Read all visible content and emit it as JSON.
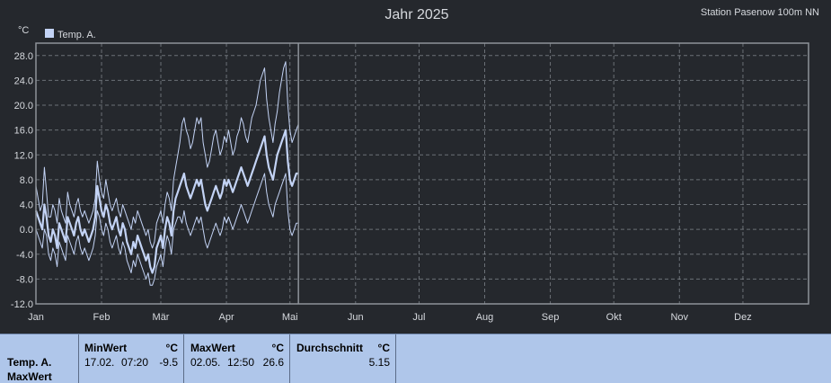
{
  "title": "Jahr 2025",
  "station": "Station Pasenow 100m NN",
  "unit": "°C",
  "colors": {
    "background": "#25282d",
    "series": "#c3d3f5",
    "panel": "#afc6ea"
  },
  "chart_data": {
    "type": "line",
    "title": "Jahr 2025",
    "ylabel": "°C",
    "ylim": [
      -12,
      30
    ],
    "yticks": [
      "28.0",
      "24.0",
      "20.0",
      "16.0",
      "12.0",
      "8.0",
      "4.0",
      "0.0",
      "-4.0",
      "-8.0",
      "-12.0"
    ],
    "ytick_values": [
      28,
      24,
      20,
      16,
      12,
      8,
      4,
      0,
      -4,
      -8,
      -12
    ],
    "xlim": [
      1,
      366
    ],
    "months": [
      "Jan",
      "Feb",
      "Mär",
      "Apr",
      "Mai",
      "Jun",
      "Jul",
      "Aug",
      "Sep",
      "Okt",
      "Nov",
      "Dez"
    ],
    "month_days": [
      1,
      32,
      60,
      91,
      121,
      152,
      182,
      213,
      244,
      274,
      305,
      335
    ],
    "data_end_day": 125,
    "grid": true,
    "legend": "top-left",
    "legend_label": "Temp. A.",
    "series": [
      {
        "name": "Temp. A.",
        "role": "max",
        "values": [
          7,
          5,
          3,
          4,
          10,
          6,
          2,
          2,
          4,
          3,
          1,
          5,
          3,
          2,
          1,
          6,
          4,
          3,
          2,
          4,
          5,
          3,
          2,
          3,
          2,
          1,
          2,
          3,
          5,
          11,
          8,
          6,
          5,
          8,
          6,
          4,
          3,
          4,
          5,
          3,
          2,
          4,
          3,
          2,
          1,
          0,
          2,
          1,
          3,
          2,
          1,
          0,
          -1,
          0,
          -2,
          -3,
          -2,
          1,
          2,
          3,
          1,
          4,
          6,
          5,
          3,
          8,
          10,
          12,
          14,
          17,
          18,
          16,
          15,
          13,
          14,
          16,
          18,
          17,
          18,
          14,
          12,
          10,
          11,
          13,
          15,
          16,
          14,
          12,
          13,
          15,
          14,
          16,
          14,
          12,
          13,
          15,
          16,
          18,
          17,
          15,
          14,
          16,
          18,
          19,
          20,
          22,
          24,
          25,
          26,
          21,
          18,
          16,
          14,
          17,
          19,
          22,
          24,
          26,
          27,
          20,
          16,
          14,
          15,
          16,
          17
        ]
      },
      {
        "name": "Temp. A.",
        "role": "mean",
        "values": [
          3,
          2,
          1,
          0,
          4,
          2,
          -1,
          -2,
          0,
          -1,
          -3,
          1,
          0,
          -1,
          -2,
          2,
          1,
          0,
          -1,
          1,
          2,
          0,
          -1,
          0,
          -1,
          -2,
          -1,
          0,
          2,
          7,
          5,
          3,
          2,
          4,
          3,
          1,
          0,
          1,
          2,
          0,
          -1,
          1,
          0,
          -2,
          -3,
          -4,
          -2,
          -3,
          -1,
          -2,
          -3,
          -4,
          -5,
          -4,
          -6,
          -7,
          -6,
          -3,
          -2,
          -1,
          -3,
          0,
          2,
          1,
          -1,
          3,
          5,
          6,
          7,
          8,
          9,
          7,
          6,
          5,
          6,
          7,
          8,
          7,
          8,
          6,
          4,
          3,
          4,
          5,
          6,
          7,
          6,
          5,
          6,
          8,
          7,
          8,
          7,
          6,
          7,
          8,
          9,
          10,
          9,
          8,
          7,
          8,
          9,
          10,
          11,
          12,
          13,
          14,
          15,
          12,
          10,
          9,
          8,
          10,
          12,
          13,
          14,
          15,
          16,
          11,
          8,
          7,
          8,
          9,
          9
        ]
      },
      {
        "name": "Temp. A.",
        "role": "min",
        "values": [
          0,
          -1,
          -2,
          -3,
          0,
          -1,
          -4,
          -5,
          -3,
          -4,
          -6,
          -2,
          -3,
          -4,
          -5,
          -1,
          -2,
          -3,
          -4,
          -2,
          -1,
          -3,
          -4,
          -3,
          -4,
          -5,
          -4,
          -3,
          -1,
          3,
          2,
          0,
          -1,
          1,
          0,
          -2,
          -3,
          -2,
          -1,
          -3,
          -4,
          -2,
          -3,
          -5,
          -6,
          -7,
          -5,
          -6,
          -4,
          -5,
          -6,
          -7,
          -8,
          -7,
          -9,
          -9,
          -8,
          -6,
          -5,
          -4,
          -6,
          -3,
          -1,
          -2,
          -4,
          0,
          1,
          2,
          2,
          1,
          3,
          1,
          0,
          -1,
          0,
          1,
          2,
          1,
          2,
          0,
          -2,
          -3,
          -2,
          -1,
          0,
          1,
          0,
          -1,
          0,
          2,
          1,
          2,
          1,
          0,
          1,
          2,
          3,
          4,
          3,
          2,
          1,
          2,
          3,
          4,
          5,
          6,
          7,
          8,
          9,
          6,
          4,
          3,
          2,
          4,
          5,
          6,
          7,
          8,
          9,
          3,
          0,
          -1,
          0,
          1,
          1
        ]
      }
    ]
  },
  "stats": {
    "row_label_1": "Temp. A.",
    "row_label_2": "MaxWert",
    "min": {
      "title": "MinWert",
      "unit": "°C",
      "date": "17.02.",
      "time": "07:20",
      "value": "-9.5"
    },
    "max": {
      "title": "MaxWert",
      "unit": "°C",
      "date": "02.05.",
      "time": "12:50",
      "value": "26.6"
    },
    "avg": {
      "title": "Durchschnitt",
      "unit": "°C",
      "value": "5.15"
    }
  }
}
